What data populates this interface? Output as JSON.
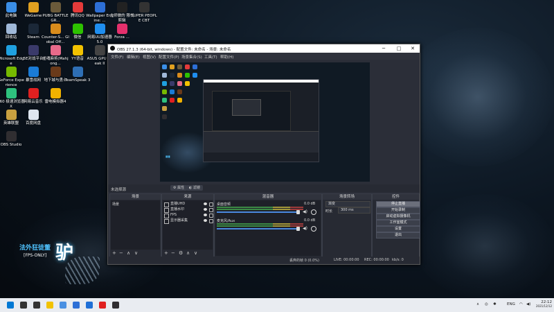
{
  "desktop_icons": [
    {
      "label": "此电脑",
      "icon": "computer-icon",
      "color": "#3a8ee6"
    },
    {
      "label": "WeGame",
      "icon": "wegame-icon",
      "color": "#e0a020"
    },
    {
      "label": "PUBG BATTLEGR...",
      "icon": "pubg-icon",
      "color": "#6b5a3a"
    },
    {
      "label": "腾讯QQ",
      "icon": "qq-icon",
      "color": "#e43a3a"
    },
    {
      "label": "Wallpaper Engine: ...",
      "icon": "wallpaper-engine-icon",
      "color": "#2d6fd6"
    },
    {
      "label": "大师做的 限代剪辑",
      "icon": "video-editor-icon",
      "color": "#222222"
    },
    {
      "label": "SUPER PEOPLE CBT",
      "icon": "super-people-icon",
      "color": "#333333"
    },
    {
      "label": "回收站",
      "icon": "recycle-bin-icon",
      "color": "#9fb8d8"
    },
    {
      "label": "Steam",
      "icon": "steam-icon",
      "color": "#1b2838"
    },
    {
      "label": "Counter-S... Global Off...",
      "icon": "csgo-icon",
      "color": "#d98c1c"
    },
    {
      "label": "微信",
      "icon": "wechat-icon",
      "color": "#2dc100"
    },
    {
      "label": "网易UU加速器5.0",
      "icon": "uu-accelerator-icon",
      "color": "#1f8ef0"
    },
    {
      "label": "Forza ...",
      "icon": "forza-icon",
      "color": "#e4306c"
    },
    {
      "label": "Microsoft Edge",
      "icon": "edge-icon",
      "color": "#1fa0e0"
    },
    {
      "label": "5E对战平台",
      "icon": "5e-platform-icon",
      "color": "#3a3a6a"
    },
    {
      "label": "雀魂麻将(Mahjong...",
      "icon": "mahjong-icon",
      "color": "#e86a8a"
    },
    {
      "label": "YY语音",
      "icon": "yy-icon",
      "color": "#f2c200"
    },
    {
      "label": "ASUS GPU Tweak II",
      "icon": "asus-gpu-icon",
      "color": "#444444"
    },
    {
      "label": "GeForce Experience",
      "icon": "geforce-icon",
      "color": "#76b900"
    },
    {
      "label": "暴雪战网",
      "icon": "battlenet-icon",
      "color": "#1a7bd6"
    },
    {
      "label": "地下城与勇士",
      "icon": "dnf-icon",
      "color": "#6a3a1a"
    },
    {
      "label": "TeamSpeak 3",
      "icon": "teamspeak-icon",
      "color": "#2e6fb5"
    },
    {
      "label": "360 极速浏览器X",
      "icon": "360-browser-icon",
      "color": "#2ec27e"
    },
    {
      "label": "网易云音乐",
      "icon": "netease-music-icon",
      "color": "#e02020"
    },
    {
      "label": "雷电模拟器4",
      "icon": "ldplayer-icon",
      "color": "#f2b200"
    },
    {
      "label": "英雄联盟",
      "icon": "lol-icon",
      "color": "#c8a040"
    },
    {
      "label": "百度网盘",
      "icon": "baidu-pan-icon",
      "color": "#dfe6f0"
    },
    {
      "label": "OBS Studio",
      "icon": "obs-icon",
      "color": "#302e31"
    }
  ],
  "watermark": {
    "title": "法外狂徒董",
    "subtitle": "[FPS-ONLY]",
    "glyph": "驴"
  },
  "obs": {
    "title": "OBS 27.1.3 (64-bit, windows) - 配置文件: 未命名 - 场景: 未命名",
    "menu": [
      "文件(F)",
      "编辑(E)",
      "视图(V)",
      "配置文件(P)",
      "场景集合(S)",
      "工具(T)",
      "帮助(H)"
    ],
    "no_source_selected": "未选择源",
    "props_tab": "属性",
    "filters_tab": "滤镜",
    "docks": {
      "scenes": {
        "title": "场景",
        "items": [
          "场景"
        ]
      },
      "sources": {
        "title": "来源",
        "items": [
          {
            "label": "直播UHD",
            "icon": "display-capture-icon"
          },
          {
            "label": "直播水印",
            "icon": "image-icon"
          },
          {
            "label": "FPS",
            "icon": "text-icon"
          },
          {
            "label": "显示器采集",
            "icon": "monitor-icon"
          }
        ]
      },
      "mixer": {
        "title": "混音器",
        "channels": [
          {
            "name": "桌面音频",
            "db": "0.0 dB"
          },
          {
            "name": "麦克风/Aux",
            "db": "0.0 dB"
          }
        ]
      },
      "transitions": {
        "title": "场景转场",
        "type": "渐变",
        "duration_label": "时长",
        "duration": "300 ms"
      },
      "controls": {
        "title": "控件",
        "buttons": [
          "停止直播",
          "开始录制",
          "启动虚拟摄像机",
          "工作室模式",
          "设置",
          "退出"
        ]
      }
    },
    "status": {
      "dropped": "丢弃的帧 0 (0.0%)",
      "live": "LIVE: 00:00:00",
      "rec": "REC: 00:00:00",
      "cpu": "CPU: 0.9%, 60.00 fps",
      "bitrate": "kb/s: 0"
    }
  },
  "taskbar": {
    "apps": [
      {
        "icon": "windows-start-icon",
        "color": "#0078d4"
      },
      {
        "icon": "search-icon",
        "color": "#333333"
      },
      {
        "icon": "task-view-icon",
        "color": "#333333"
      },
      {
        "icon": "file-explorer-icon",
        "color": "#f2c200"
      },
      {
        "icon": "chrome-icon",
        "color": "#4a90e2"
      },
      {
        "icon": "store-icon",
        "color": "#2d6fd6"
      },
      {
        "icon": "mail-icon",
        "color": "#1f6fd6"
      },
      {
        "icon": "netease-music-icon",
        "color": "#e02020"
      },
      {
        "icon": "obs-icon",
        "color": "#302e31"
      }
    ],
    "tray_lang": "ENG",
    "tray_time": "22:12",
    "tray_date": "2021/12/12"
  }
}
